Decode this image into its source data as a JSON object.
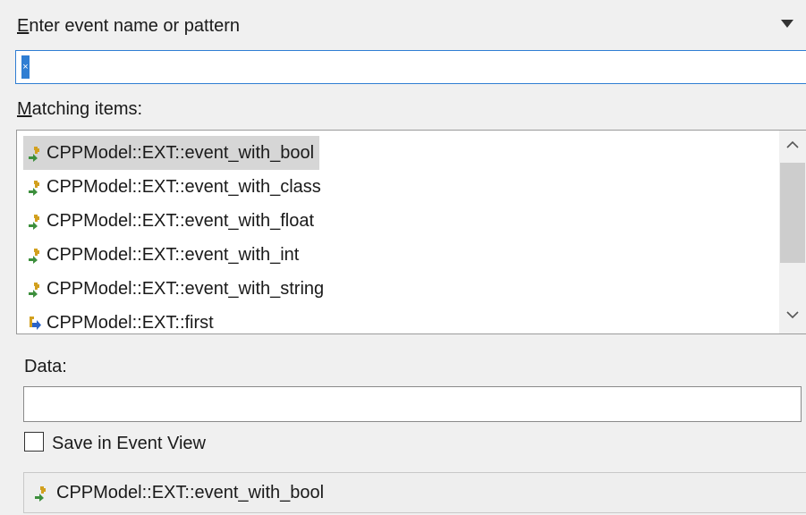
{
  "header": {
    "mnemonic": "E",
    "label_rest": "nter event name or pattern"
  },
  "search": {
    "value": ""
  },
  "matching": {
    "mnemonic": "M",
    "label_rest": "atching items:"
  },
  "items": [
    {
      "label": "CPPModel::EXT::event_with_bool",
      "icon": "event-icon",
      "selected": true
    },
    {
      "label": "CPPModel::EXT::event_with_class",
      "icon": "event-icon",
      "selected": false
    },
    {
      "label": "CPPModel::EXT::event_with_float",
      "icon": "event-icon",
      "selected": false
    },
    {
      "label": "CPPModel::EXT::event_with_int",
      "icon": "event-icon",
      "selected": false
    },
    {
      "label": "CPPModel::EXT::event_with_string",
      "icon": "event-icon",
      "selected": false
    },
    {
      "label": "CPPModel::EXT::first",
      "icon": "triggered-event-icon",
      "selected": false
    }
  ],
  "data": {
    "label": "Data:",
    "value": ""
  },
  "save": {
    "label": "Save in Event View",
    "checked": false
  },
  "status": {
    "text": "CPPModel::EXT::event_with_bool",
    "icon": "event-icon"
  },
  "colors": {
    "accent": "#2f7ed3",
    "selection": "#d6d6d6",
    "icon_green": "#3d8f3d",
    "icon_gold": "#d2a01e",
    "icon_blue": "#2a63c8"
  }
}
